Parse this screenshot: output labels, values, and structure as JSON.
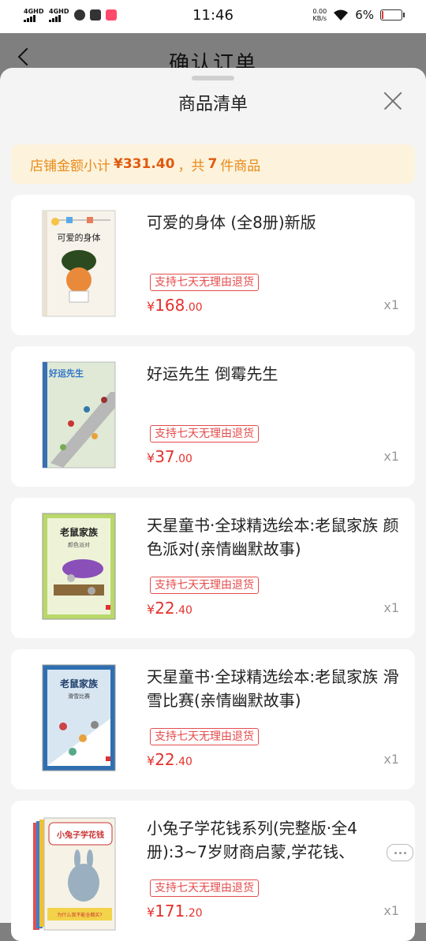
{
  "status_bar": {
    "signal1": "4GHD",
    "signal2": "4GHD",
    "time": "11:46",
    "speed_value": "0.00",
    "speed_unit": "KB/s",
    "battery": "6%"
  },
  "page": {
    "title": "确认订单"
  },
  "sheet": {
    "title": "商品清单",
    "summary": {
      "prefix": "店铺金额小计",
      "amount": "¥331.40",
      "middle": "，共",
      "count": "7",
      "suffix": "件商品"
    },
    "items": [
      {
        "title": "可爱的身体 (全8册)新版",
        "badge": "支持七天无理由退货",
        "price_yen": "¥",
        "price_int": "168",
        "price_dec": ".00",
        "qty": "x1",
        "cover_text": "可爱的身体"
      },
      {
        "title": "好运先生 倒霉先生",
        "badge": "支持七天无理由退货",
        "price_yen": "¥",
        "price_int": "37",
        "price_dec": ".00",
        "qty": "x1",
        "cover_text": "好运先生"
      },
      {
        "title": "天星童书·全球精选绘本:老鼠家族 颜色派对(亲情幽默故事)",
        "badge": "支持七天无理由退货",
        "price_yen": "¥",
        "price_int": "22",
        "price_dec": ".40",
        "qty": "x1",
        "cover_text": "老鼠家族",
        "cover_sub": "颜色派对"
      },
      {
        "title": "天星童书·全球精选绘本:老鼠家族 滑雪比赛(亲情幽默故事)",
        "badge": "支持七天无理由退货",
        "price_yen": "¥",
        "price_int": "22",
        "price_dec": ".40",
        "qty": "x1",
        "cover_text": "老鼠家族",
        "cover_sub": "滑雪比赛"
      },
      {
        "title": "小兔子学花钱系列(完整版·全4册):3~7岁财商启蒙,学花钱、",
        "badge": "支持七天无理由退货",
        "price_yen": "¥",
        "price_int": "171",
        "price_dec": ".20",
        "qty": "x1",
        "cover_text": "小兔子学花钱",
        "cover_sub": "为什么我不能全都买?"
      }
    ]
  },
  "colors": {
    "price_red": "#e5312c",
    "summary_bg": "#fdf3dc",
    "summary_text": "#e88a1a",
    "badge_red": "#e54c4c"
  }
}
